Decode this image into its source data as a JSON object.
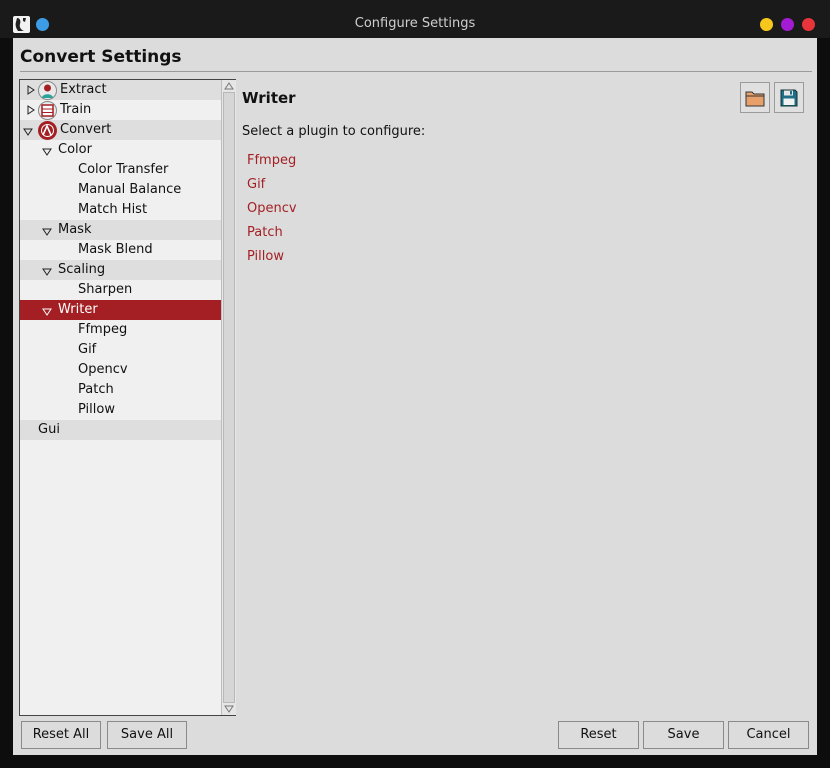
{
  "window": {
    "title": "Configure Settings"
  },
  "header": {
    "title": "Convert Settings"
  },
  "tree": {
    "extract": "Extract",
    "train": "Train",
    "convert": "Convert",
    "color": "Color",
    "color_transfer": "Color Transfer",
    "manual_balance": "Manual Balance",
    "match_hist": "Match Hist",
    "mask": "Mask",
    "mask_blend": "Mask Blend",
    "scaling": "Scaling",
    "sharpen": "Sharpen",
    "writer": "Writer",
    "ffmpeg": "Ffmpeg",
    "gif": "Gif",
    "opencv": "Opencv",
    "patch": "Patch",
    "pillow": "Pillow",
    "gui": "Gui"
  },
  "panel": {
    "title": "Writer",
    "hint": "Select a plugin to configure:",
    "plugins": [
      "Ffmpeg",
      "Gif",
      "Opencv",
      "Patch",
      "Pillow"
    ]
  },
  "buttons": {
    "reset_all": "Reset All",
    "save_all": "Save All",
    "reset": "Reset",
    "save": "Save",
    "cancel": "Cancel"
  },
  "icons": {
    "open_folder": "folder-open-icon",
    "save_disk": "floppy-disk-icon"
  },
  "colors": {
    "accent": "#a31f24",
    "link": "#a31f24",
    "window_bg": "#dcdcdc"
  }
}
